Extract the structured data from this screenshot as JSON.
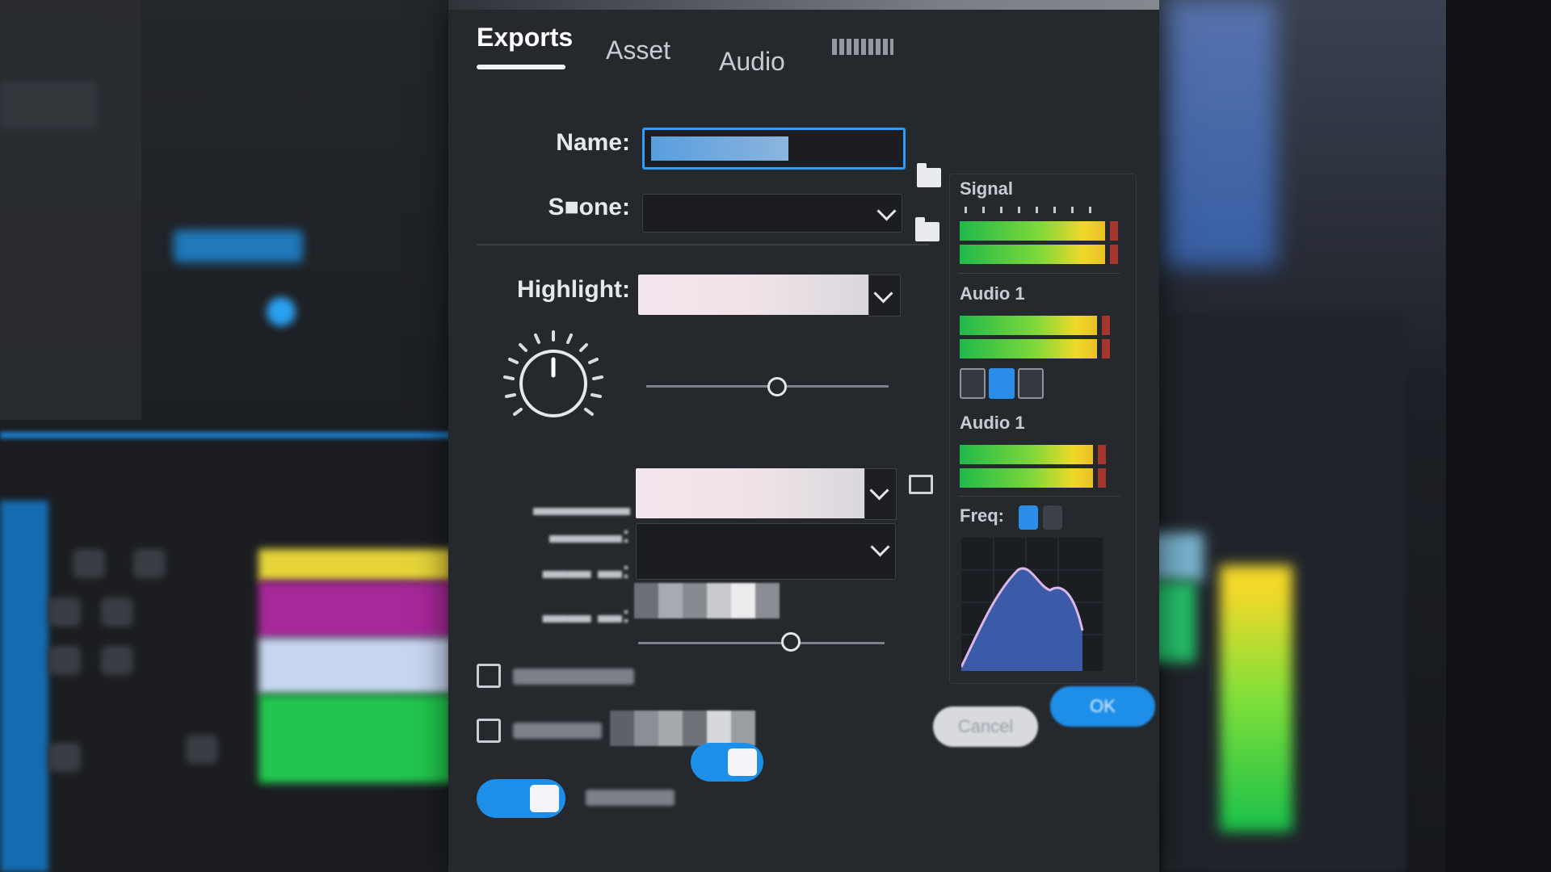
{
  "dialog": {
    "tabs": [
      {
        "label": "Exports",
        "active": true
      },
      {
        "label": "Asset",
        "active": false
      },
      {
        "label": "Audio",
        "active": false
      }
    ],
    "fields": {
      "name_label": "Name:",
      "scene_label": "S■one:",
      "highlight_label": "Highlight:"
    },
    "buttons": {
      "cancel_label": "Cancel",
      "ok_label": "OK"
    }
  },
  "meters": {
    "signal_label": "Signal",
    "audio1_label": "Audio 1",
    "audio2_label": "Audio 1",
    "freq_label": "Freq:"
  },
  "colors": {
    "accent": "#1d8fe8",
    "focus": "#2d9cff",
    "meter_green": "#1fb94a",
    "meter_yellow": "#f0d82a",
    "meter_peak": "#c6392e"
  },
  "levels": {
    "knob_fraction": 0.5,
    "slider1_fraction": 0.54,
    "slider2_fraction": 0.62,
    "toggle1_on": true,
    "toggle2_on": true
  }
}
